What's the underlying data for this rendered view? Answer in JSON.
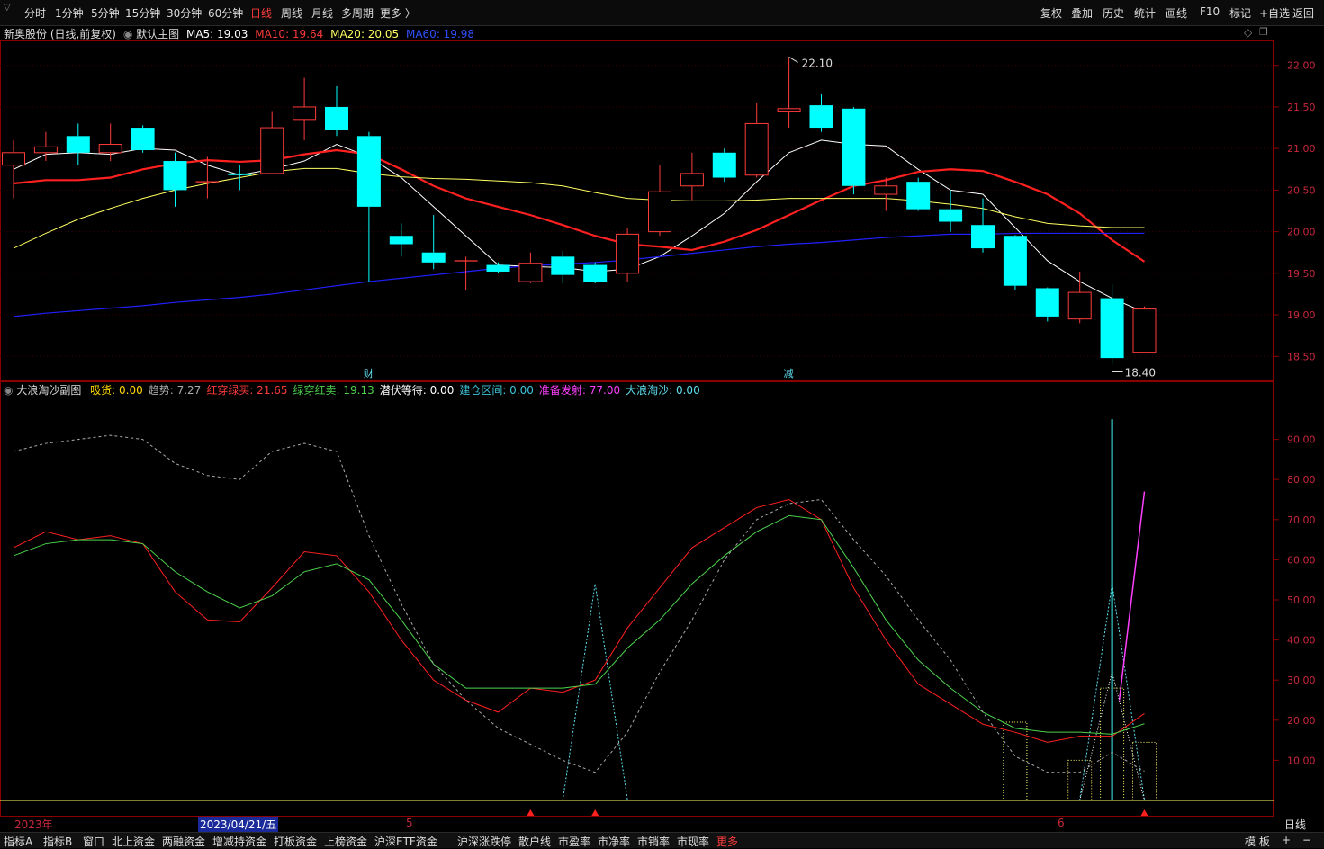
{
  "toolbar": {
    "periods": [
      "分时",
      "1分钟",
      "5分钟",
      "15分钟",
      "30分钟",
      "60分钟",
      "日线",
      "周线",
      "月线",
      "多周期",
      "更多 〉"
    ],
    "active_period": "日线",
    "right_tools": [
      "复权",
      "叠加",
      "历史",
      "统计",
      "画线",
      "F10",
      "标记",
      "+自选",
      "返回"
    ]
  },
  "main_legend": {
    "stock": "新奥股份 (日线,前复权)",
    "template": "默认主图",
    "ma5": "MA5: 19.03",
    "ma10": "MA10: 19.64",
    "ma20": "MA20: 20.05",
    "ma60": "MA60: 19.98"
  },
  "sub_legend": {
    "name": "大浪淘沙副图",
    "items": [
      {
        "text": "吸货: 0.00",
        "color": "#ffd700"
      },
      {
        "text": "趋势: 7.27",
        "color": "#aaaaaa"
      },
      {
        "text": "红穿绿买: 21.65",
        "color": "#ff3b3b"
      },
      {
        "text": "绿穿红卖: 19.13",
        "color": "#4cd44c"
      },
      {
        "text": "潜伏等待: 0.00",
        "color": "#ffffff"
      },
      {
        "text": "建仓区间: 0.00",
        "color": "#3ec3d8"
      },
      {
        "text": "准备发射: 77.00",
        "color": "#ff40ff"
      },
      {
        "text": "大浪淘沙: 0.00",
        "color": "#5fe0f0"
      }
    ]
  },
  "annotations": {
    "high": "22.10",
    "low": "18.40",
    "mark1": "财",
    "mark2": "减"
  },
  "date_axis": {
    "year": "2023年",
    "cursor_date": "2023/04/21/五",
    "month5": "5",
    "month6": "6",
    "period": "日线"
  },
  "bottom_tabs": [
    "指标A",
    "指标B",
    "窗口",
    "北上资金",
    "两融资金",
    "增减持资金",
    "打板资金",
    "上榜资金",
    "沪深ETF资金",
    "沪深涨跌停",
    "散户线",
    "市盈率",
    "市净率",
    "市销率",
    "市现率",
    "更多"
  ],
  "bottom_right": [
    "模 板",
    "+",
    "−"
  ],
  "colors": {
    "up": "#ff3b3b",
    "down": "#00ffff",
    "ma5": "#ffffff",
    "ma10": "#ff2020",
    "ma20": "#ffff60",
    "ma60": "#2020ff"
  },
  "chart_data": [
    {
      "type": "candlestick",
      "title": "新奥股份 (日线,前复权)",
      "ylim": [
        18.2,
        22.3
      ],
      "yticks": [
        "22.00",
        "21.50",
        "21.00",
        "20.50",
        "20.00",
        "19.50",
        "19.00",
        "18.50"
      ],
      "candles": [
        {
          "o": 20.8,
          "c": 20.95,
          "h": 21.1,
          "l": 20.4
        },
        {
          "o": 20.95,
          "c": 21.02,
          "h": 21.2,
          "l": 20.85
        },
        {
          "o": 21.15,
          "c": 20.95,
          "h": 21.3,
          "l": 20.8
        },
        {
          "o": 20.95,
          "c": 21.05,
          "h": 21.3,
          "l": 20.85
        },
        {
          "o": 21.25,
          "c": 20.98,
          "h": 21.28,
          "l": 20.95
        },
        {
          "o": 20.85,
          "c": 20.5,
          "h": 20.95,
          "l": 20.3
        },
        {
          "o": 20.6,
          "c": 20.6,
          "h": 20.9,
          "l": 20.4
        },
        {
          "o": 20.7,
          "c": 20.68,
          "h": 20.8,
          "l": 20.5
        },
        {
          "o": 20.7,
          "c": 21.25,
          "h": 21.45,
          "l": 20.7
        },
        {
          "o": 21.35,
          "c": 21.5,
          "h": 21.85,
          "l": 21.1
        },
        {
          "o": 21.5,
          "c": 21.22,
          "h": 21.75,
          "l": 21.15
        },
        {
          "o": 21.15,
          "c": 20.3,
          "h": 21.2,
          "l": 19.4
        },
        {
          "o": 19.95,
          "c": 19.85,
          "h": 20.1,
          "l": 19.7
        },
        {
          "o": 19.75,
          "c": 19.63,
          "h": 20.2,
          "l": 19.55
        },
        {
          "o": 19.65,
          "c": 19.65,
          "h": 19.7,
          "l": 19.3
        },
        {
          "o": 19.6,
          "c": 19.52,
          "h": 19.63,
          "l": 19.5
        },
        {
          "o": 19.4,
          "c": 19.62,
          "h": 19.75,
          "l": 19.38
        },
        {
          "o": 19.7,
          "c": 19.48,
          "h": 19.77,
          "l": 19.38
        },
        {
          "o": 19.6,
          "c": 19.4,
          "h": 19.63,
          "l": 19.38
        },
        {
          "o": 19.5,
          "c": 19.97,
          "h": 20.05,
          "l": 19.4
        },
        {
          "o": 20.0,
          "c": 20.48,
          "h": 20.8,
          "l": 19.95
        },
        {
          "o": 20.55,
          "c": 20.7,
          "h": 20.95,
          "l": 20.38
        },
        {
          "o": 20.95,
          "c": 20.65,
          "h": 21.0,
          "l": 20.6
        },
        {
          "o": 20.68,
          "c": 21.3,
          "h": 21.55,
          "l": 20.65
        },
        {
          "o": 21.45,
          "c": 21.48,
          "h": 22.1,
          "l": 21.25
        },
        {
          "o": 21.52,
          "c": 21.25,
          "h": 21.65,
          "l": 21.2
        },
        {
          "o": 21.48,
          "c": 20.55,
          "h": 21.5,
          "l": 20.45
        },
        {
          "o": 20.45,
          "c": 20.55,
          "h": 20.65,
          "l": 20.25
        },
        {
          "o": 20.6,
          "c": 20.27,
          "h": 20.65,
          "l": 20.25
        },
        {
          "o": 20.27,
          "c": 20.12,
          "h": 20.5,
          "l": 20.0
        },
        {
          "o": 20.08,
          "c": 19.8,
          "h": 20.4,
          "l": 19.75
        },
        {
          "o": 19.95,
          "c": 19.35,
          "h": 19.96,
          "l": 19.3
        },
        {
          "o": 19.32,
          "c": 18.98,
          "h": 19.33,
          "l": 18.92
        },
        {
          "o": 18.95,
          "c": 19.27,
          "h": 19.52,
          "l": 18.9
        },
        {
          "o": 19.2,
          "c": 18.48,
          "h": 19.37,
          "l": 18.4
        },
        {
          "o": 18.55,
          "c": 19.07,
          "h": 19.1,
          "l": 18.55
        }
      ],
      "series": [
        {
          "name": "MA5",
          "color": "#ffffff",
          "values": [
            20.75,
            20.93,
            20.95,
            20.93,
            21.0,
            20.98,
            20.8,
            20.68,
            20.75,
            20.85,
            21.05,
            20.9,
            20.65,
            20.3,
            19.95,
            19.6,
            19.58,
            19.57,
            19.52,
            19.55,
            19.7,
            19.95,
            20.22,
            20.6,
            20.95,
            21.1,
            21.05,
            21.03,
            20.75,
            20.5,
            20.45,
            20.05,
            19.65,
            19.4,
            19.2,
            19.03
          ]
        },
        {
          "name": "MA10",
          "color": "#ff2020",
          "values": [
            20.58,
            20.62,
            20.62,
            20.65,
            20.75,
            20.82,
            20.86,
            20.84,
            20.86,
            20.93,
            20.98,
            20.93,
            20.75,
            20.55,
            20.4,
            20.3,
            20.2,
            20.08,
            19.95,
            19.85,
            19.82,
            19.78,
            19.88,
            20.02,
            20.2,
            20.38,
            20.55,
            20.62,
            20.72,
            20.75,
            20.73,
            20.6,
            20.45,
            20.22,
            19.9,
            19.64
          ]
        },
        {
          "name": "MA20",
          "color": "#ffff60",
          "values": [
            19.8,
            19.98,
            20.15,
            20.28,
            20.4,
            20.5,
            20.58,
            20.65,
            20.72,
            20.76,
            20.76,
            20.7,
            20.66,
            20.64,
            20.63,
            20.61,
            20.59,
            20.55,
            20.47,
            20.4,
            20.38,
            20.37,
            20.37,
            20.38,
            20.4,
            20.4,
            20.4,
            20.4,
            20.37,
            20.33,
            20.28,
            20.18,
            20.1,
            20.07,
            20.05,
            20.05
          ]
        },
        {
          "name": "MA60",
          "color": "#2020ff",
          "values": [
            18.98,
            19.02,
            19.05,
            19.08,
            19.11,
            19.15,
            19.18,
            19.21,
            19.25,
            19.3,
            19.35,
            19.4,
            19.44,
            19.48,
            19.52,
            19.56,
            19.59,
            19.61,
            19.63,
            19.66,
            19.7,
            19.74,
            19.78,
            19.82,
            19.85,
            19.87,
            19.9,
            19.93,
            19.95,
            19.97,
            19.97,
            19.98,
            19.98,
            19.98,
            19.98,
            19.98
          ]
        }
      ]
    },
    {
      "type": "line",
      "title": "大浪淘沙副图",
      "ylim": [
        0,
        100
      ],
      "yticks": [
        "90.00",
        "80.00",
        "70.00",
        "60.00",
        "50.00",
        "40.00",
        "30.00",
        "20.00",
        "10.00"
      ],
      "series": [
        {
          "name": "红穿绿买",
          "color": "#ff2020",
          "values": [
            63,
            67,
            65,
            66,
            64,
            52,
            45,
            44.5,
            53,
            62,
            61,
            52,
            40,
            30,
            25,
            22,
            28,
            27,
            30,
            43,
            53,
            63,
            68,
            73,
            75,
            70,
            53,
            40,
            29,
            24,
            19,
            17,
            14.5,
            16,
            16,
            21.65
          ]
        },
        {
          "name": "绿穿红卖",
          "color": "#4cd44c",
          "values": [
            61,
            64,
            65,
            65,
            64,
            57,
            52,
            48,
            51,
            57,
            59,
            55,
            45,
            34,
            28,
            28,
            28,
            28,
            29,
            38,
            45,
            54,
            61,
            67,
            71,
            70,
            58,
            45,
            35,
            28,
            22,
            18,
            17,
            17,
            16.5,
            19.13
          ]
        },
        {
          "name": "趋势",
          "color": "#aaaaaa",
          "dashed": true,
          "values": [
            87,
            89,
            90,
            91,
            90,
            84,
            81,
            80,
            87,
            89,
            87,
            66,
            49,
            34,
            25,
            18,
            14,
            10,
            7,
            17,
            32,
            45,
            60,
            70,
            74,
            75,
            65,
            56,
            45,
            35,
            22,
            11,
            7,
            7,
            12,
            7.27
          ]
        }
      ]
    }
  ]
}
